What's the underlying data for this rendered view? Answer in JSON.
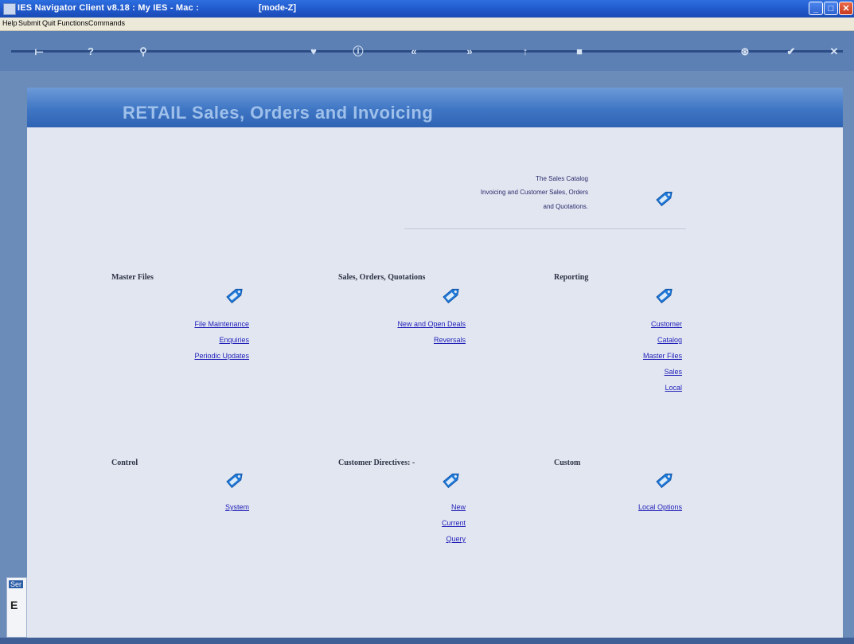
{
  "window": {
    "title": "IES Navigator Client v8.18 : My IES - Mac :",
    "mode": "[mode-Z]"
  },
  "menu": [
    "Help",
    "Submit",
    "Quit",
    "Functions",
    "Commands"
  ],
  "toolbar": {
    "icons": [
      "home-icon",
      "help-icon",
      "search-icon",
      "favorite-icon",
      "info-icon",
      "back-icon",
      "forward-icon",
      "up-icon",
      "stop-icon",
      "settings-icon",
      "confirm-icon",
      "close-icon"
    ]
  },
  "banner": {
    "title": "RETAIL Sales, Orders and Invoicing"
  },
  "intro": {
    "lines": [
      "The Sales Catalog",
      "Invoicing and Customer Sales, Orders",
      "and Quotations."
    ]
  },
  "sections": {
    "master_files": {
      "title": "Master Files",
      "links": [
        "File Maintenance",
        "Enquiries",
        "Periodic Updates"
      ]
    },
    "sales_orders": {
      "title": "Sales, Orders, Quotations",
      "links": [
        "New and Open Deals",
        "Reversals"
      ]
    },
    "reporting": {
      "title": "Reporting",
      "links": [
        "Customer",
        "Catalog",
        "Master Files",
        "Sales",
        "Local"
      ]
    },
    "control": {
      "title": "Control",
      "links": [
        "System"
      ]
    },
    "customer_directives": {
      "title": "Customer Directives: -",
      "links": [
        "New",
        "Current",
        "Query"
      ]
    },
    "custom": {
      "title": "Custom",
      "links": [
        "Local Options"
      ]
    }
  },
  "side_tab": {
    "label": "Ser",
    "value": "E"
  },
  "colors": {
    "accent": "#2e63b3",
    "tag": "#1e78d8",
    "link": "#1f1fb8"
  }
}
